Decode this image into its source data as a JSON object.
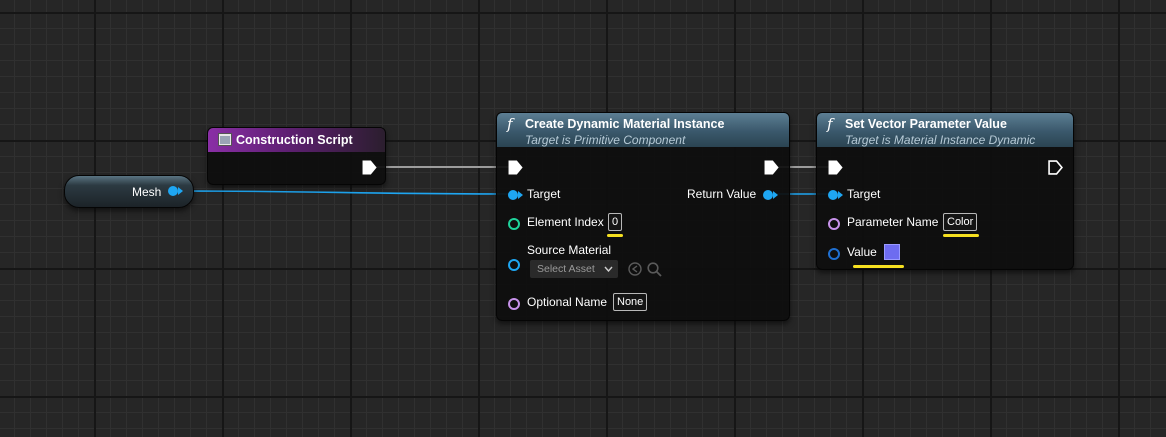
{
  "variable_node": {
    "label": "Mesh"
  },
  "construction_node": {
    "title": "Construction Script"
  },
  "create_node": {
    "func_icon": "f",
    "title": "Create Dynamic Material Instance",
    "subtitle": "Target is Primitive Component",
    "target_label": "Target",
    "return_label": "Return Value",
    "element_index_label": "Element Index",
    "element_index_value": "0",
    "source_material_label": "Source Material",
    "select_asset_placeholder": "Select Asset",
    "optional_name_label": "Optional Name",
    "optional_name_value": "None"
  },
  "setvec_node": {
    "func_icon": "f",
    "title": "Set Vector Parameter Value",
    "subtitle": "Target is Material Instance Dynamic",
    "target_label": "Target",
    "param_name_label": "Parameter Name",
    "param_name_value": "Color",
    "value_label": "Value",
    "value_color": "#6e6cf0"
  },
  "colors": {
    "object_pin": "#1ea6f2",
    "int_pin": "#1fd39b",
    "name_pin": "#c792ea",
    "linear_color_pin": "#1f6fd0",
    "highlight": "#f6e020"
  }
}
